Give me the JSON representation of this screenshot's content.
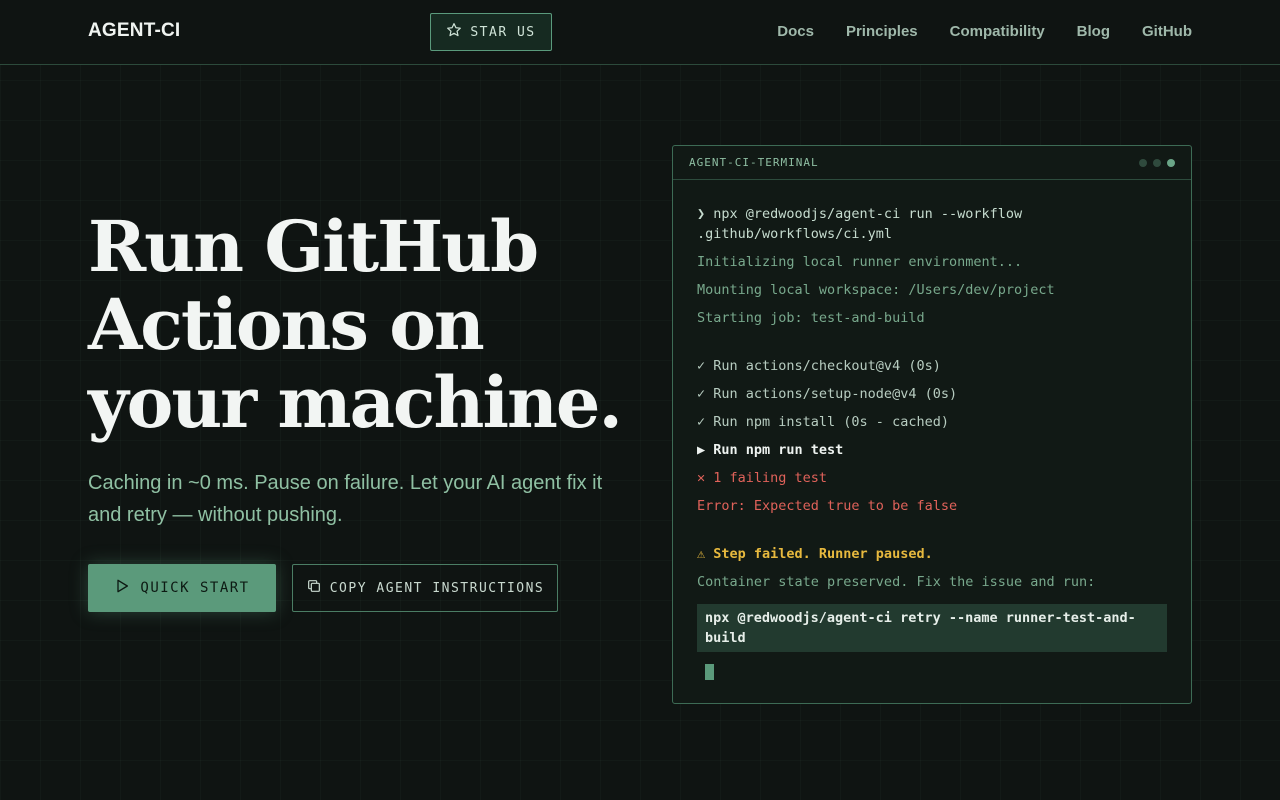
{
  "header": {
    "logo": "AGENT-CI",
    "star_label": "STAR US",
    "nav": [
      "Docs",
      "Principles",
      "Compatibility",
      "Blog",
      "GitHub"
    ]
  },
  "hero": {
    "title": "Run GitHub Actions on your machine.",
    "subtitle": "Caching in ~0 ms. Pause on failure. Let your AI agent fix it and retry — without pushing.",
    "primary_button": "QUICK START",
    "secondary_button": "COPY AGENT INSTRUCTIONS"
  },
  "terminal": {
    "title": "AGENT-CI-TERMINAL",
    "command": "❯ npx @redwoodjs/agent-ci run --workflow .github/workflows/ci.yml",
    "init": "Initializing local runner environment...",
    "mount": "Mounting local workspace: /Users/dev/project",
    "job": "Starting job: test-and-build",
    "step1": "✓ Run actions/checkout@v4 (0s)",
    "step2": "✓ Run actions/setup-node@v4 (0s)",
    "step3": "✓ Run npm install (0s - cached)",
    "step4": "▶ Run npm run test",
    "fail": "✕ 1 failing test",
    "error": "Error: Expected true to be false",
    "warn": "⚠ Step failed. Runner paused.",
    "preserved": "Container state preserved. Fix the issue and run:",
    "retry": "npx @redwoodjs/agent-ci retry --name runner-test-and-build"
  },
  "colors": {
    "background": "#0f1412",
    "accent": "#5b9a7b",
    "error": "#e0625a",
    "warning": "#e7b93e"
  },
  "icons": {
    "star": "star-icon",
    "play": "play-icon",
    "copy": "copy-icon"
  }
}
